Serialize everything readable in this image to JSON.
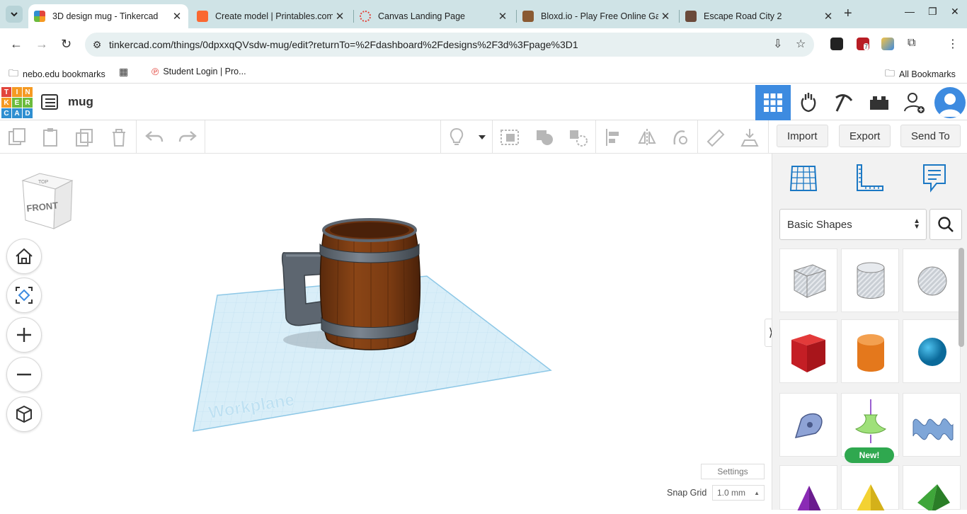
{
  "browser": {
    "tabs": [
      {
        "title": "3D design mug - Tinkercad",
        "active": true
      },
      {
        "title": "Create model | Printables.com",
        "active": false
      },
      {
        "title": "Canvas Landing Page",
        "active": false
      },
      {
        "title": "Bloxd.io - Play Free Online Games",
        "active": false
      },
      {
        "title": "Escape Road City 2",
        "active": false
      }
    ],
    "url": "tinkercad.com/things/0dpxxqQVsdw-mug/edit?returnTo=%2Fdashboard%2Fdesigns%2F3d%3Fpage%3D1",
    "extension_badge": "7",
    "bookmarks": [
      {
        "label": "nebo.edu bookmarks"
      },
      {
        "label": "Student Login | Pro..."
      }
    ],
    "all_bookmarks": "All Bookmarks"
  },
  "tinkercad": {
    "logo_letters": [
      "T",
      "I",
      "N",
      "K",
      "E",
      "R",
      "C",
      "A",
      "D"
    ],
    "design_title": "mug",
    "actions": {
      "import": "Import",
      "export": "Export",
      "send_to": "Send To"
    },
    "viewcube": {
      "top": "TOP",
      "front": "FRONT"
    },
    "workplane_label": "Workplane",
    "settings_label": "Settings",
    "snap_grid_label": "Snap Grid",
    "snap_grid_value": "1.0 mm",
    "shape_library": "Basic Shapes",
    "new_badge": "New!"
  },
  "colors": {
    "tinkercad_blue": "#3d8be0",
    "logo_red": "#e2453c",
    "logo_orange": "#f59a23",
    "logo_green": "#6cbb3c",
    "logo_blue": "#2f8fd1",
    "workplane": "#d9eef8",
    "mug_body": "#7a3b12",
    "mug_band": "#5d6670"
  }
}
